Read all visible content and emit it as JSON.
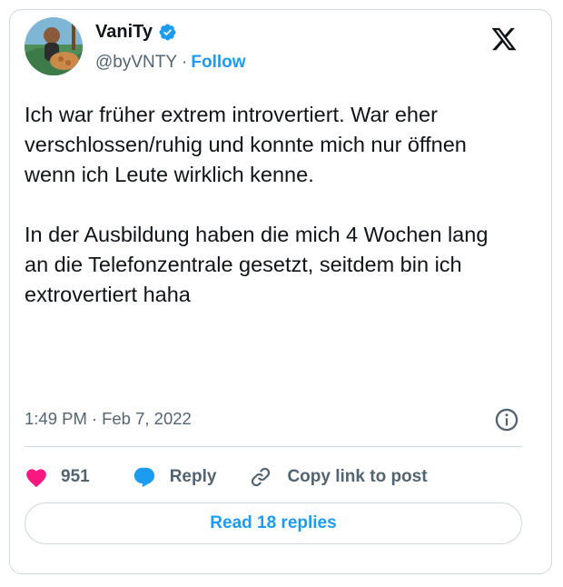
{
  "author": {
    "name": "VaniTy",
    "handle": "@byVNTY",
    "separator": "·",
    "follow_label": "Follow",
    "avatar_icon": "avatar-image",
    "verified_icon": "verified-badge-icon"
  },
  "tweet": {
    "text": "Ich war früher extrem introvertiert. War eher verschlossen/ruhig und konnte mich nur öffnen wenn ich Leute wirklich kenne.\n\nIn der Ausbildung haben die mich 4 Wochen lang an die Telefonzentrale gesetzt, seitdem bin ich extrovertiert haha",
    "time": "1:49 PM",
    "separator": "·",
    "date": "Feb 7, 2022"
  },
  "actions": {
    "likes": "951",
    "reply_label": "Reply",
    "copy_label": "Copy link to post"
  },
  "read_replies_label": "Read 18 replies",
  "colors": {
    "accent": "#1d9bf0",
    "like": "#f91880",
    "text": "#0f1419",
    "muted": "#536471",
    "border": "#cfd9de"
  }
}
